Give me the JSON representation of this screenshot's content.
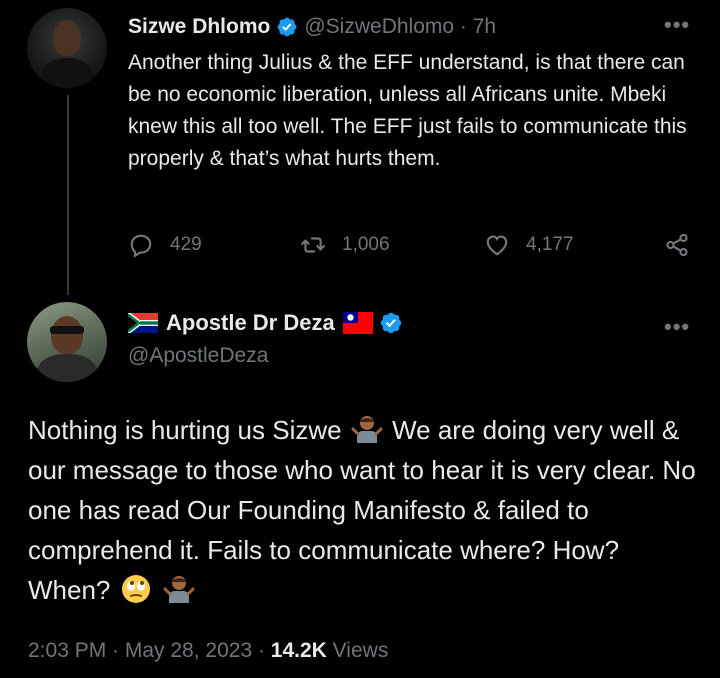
{
  "tweet1": {
    "name": "Sizwe Dhlomo",
    "handle": "@SizweDhlomo",
    "separator": " · ",
    "time": "7h",
    "text": "Another thing Julius & the EFF understand, is that there can be no economic liberation, unless all Africans unite. Mbeki knew this all too well. The EFF just fails to communicate this properly & that’s what hurts them.",
    "replies": "429",
    "retweets": "1,006",
    "likes": "4,177",
    "verified": true
  },
  "tweet2": {
    "name": "Apostle Dr Deza",
    "handle": "@ApostleDeza",
    "verified": true,
    "text_part1": "Nothing is hurting us Sizwe",
    "text_part2": "We are doing very well & our message to those who want to hear it is very clear. No one has read Our Founding Manifesto & failed to comprehend it. Fails to communicate where? How? When?",
    "timestamp": "2:03 PM · May 28, 2023 · ",
    "views_count": "14.2K",
    "views_label": " Views"
  },
  "icons": {
    "reply": "reply-icon",
    "retweet": "retweet-icon",
    "like": "heart-icon",
    "share": "share-icon",
    "more": "more-icon",
    "verified": "verified-badge-icon"
  },
  "colors": {
    "background": "#000000",
    "text": "#e7e9ea",
    "muted": "#71767b",
    "verified": "#1d9bf0"
  }
}
